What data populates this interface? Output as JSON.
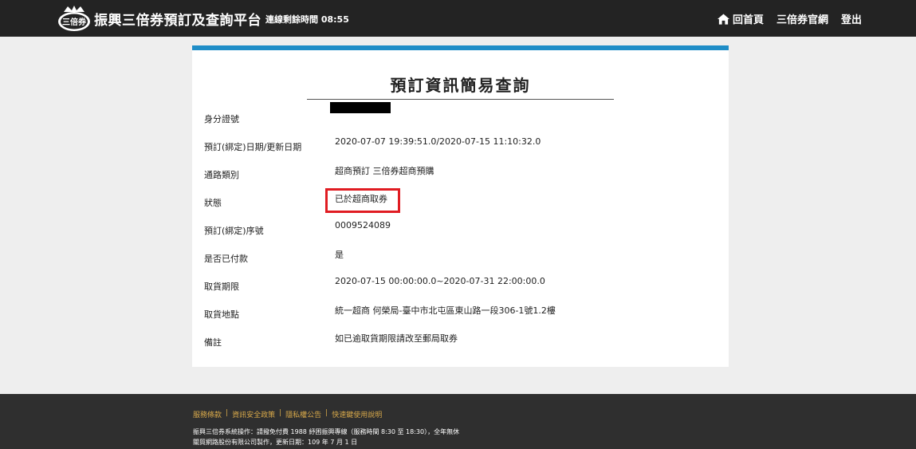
{
  "header": {
    "site_title": "振興三倍券預訂及查詢平台",
    "session_timer": "連線剩餘時間 08:55",
    "nav": {
      "home": "回首頁",
      "official_site": "三倍券官網",
      "logout": "登出"
    },
    "logo_text": "三倍券"
  },
  "card": {
    "title": "預訂資訊簡易查詢",
    "rows": [
      {
        "label": "身分證號",
        "value": ""
      },
      {
        "label": "預訂(綁定)日期/更新日期",
        "value": "2020-07-07 19:39:51.0/2020-07-15 11:10:32.0"
      },
      {
        "label": "通路類別",
        "value": "超商預訂 三倍券超商預購"
      },
      {
        "label": "狀態",
        "value": "已於超商取券"
      },
      {
        "label": "預訂(綁定)序號",
        "value": "0009524089"
      },
      {
        "label": "是否已付款",
        "value": "是"
      },
      {
        "label": "取貨期限",
        "value": "2020-07-15 00:00:00.0~2020-07-31 22:00:00.0"
      },
      {
        "label": "取貨地點",
        "value": "統一超商 何榮局-臺中市北屯區東山路一段306-1號1.2樓"
      },
      {
        "label": "備註",
        "value": "如已逾取貨期限請改至郵局取券"
      }
    ]
  },
  "footer": {
    "links": [
      "服務條款",
      "資訊安全政策",
      "隱私權公告",
      "快速鍵使用說明"
    ],
    "line1": "振興三倍券系統操作：請撥免付費 1988 紓困振興專線（服務時間 8:30 至 18:30），全年無休",
    "line2": "關貿網路股份有限公司製作，更新日期：109 年 7 月 1 日"
  },
  "colors": {
    "topbar": "#232323",
    "accent": "#1f8dc7",
    "highlight": "#e01c22",
    "footer_link": "#d7a84a"
  }
}
